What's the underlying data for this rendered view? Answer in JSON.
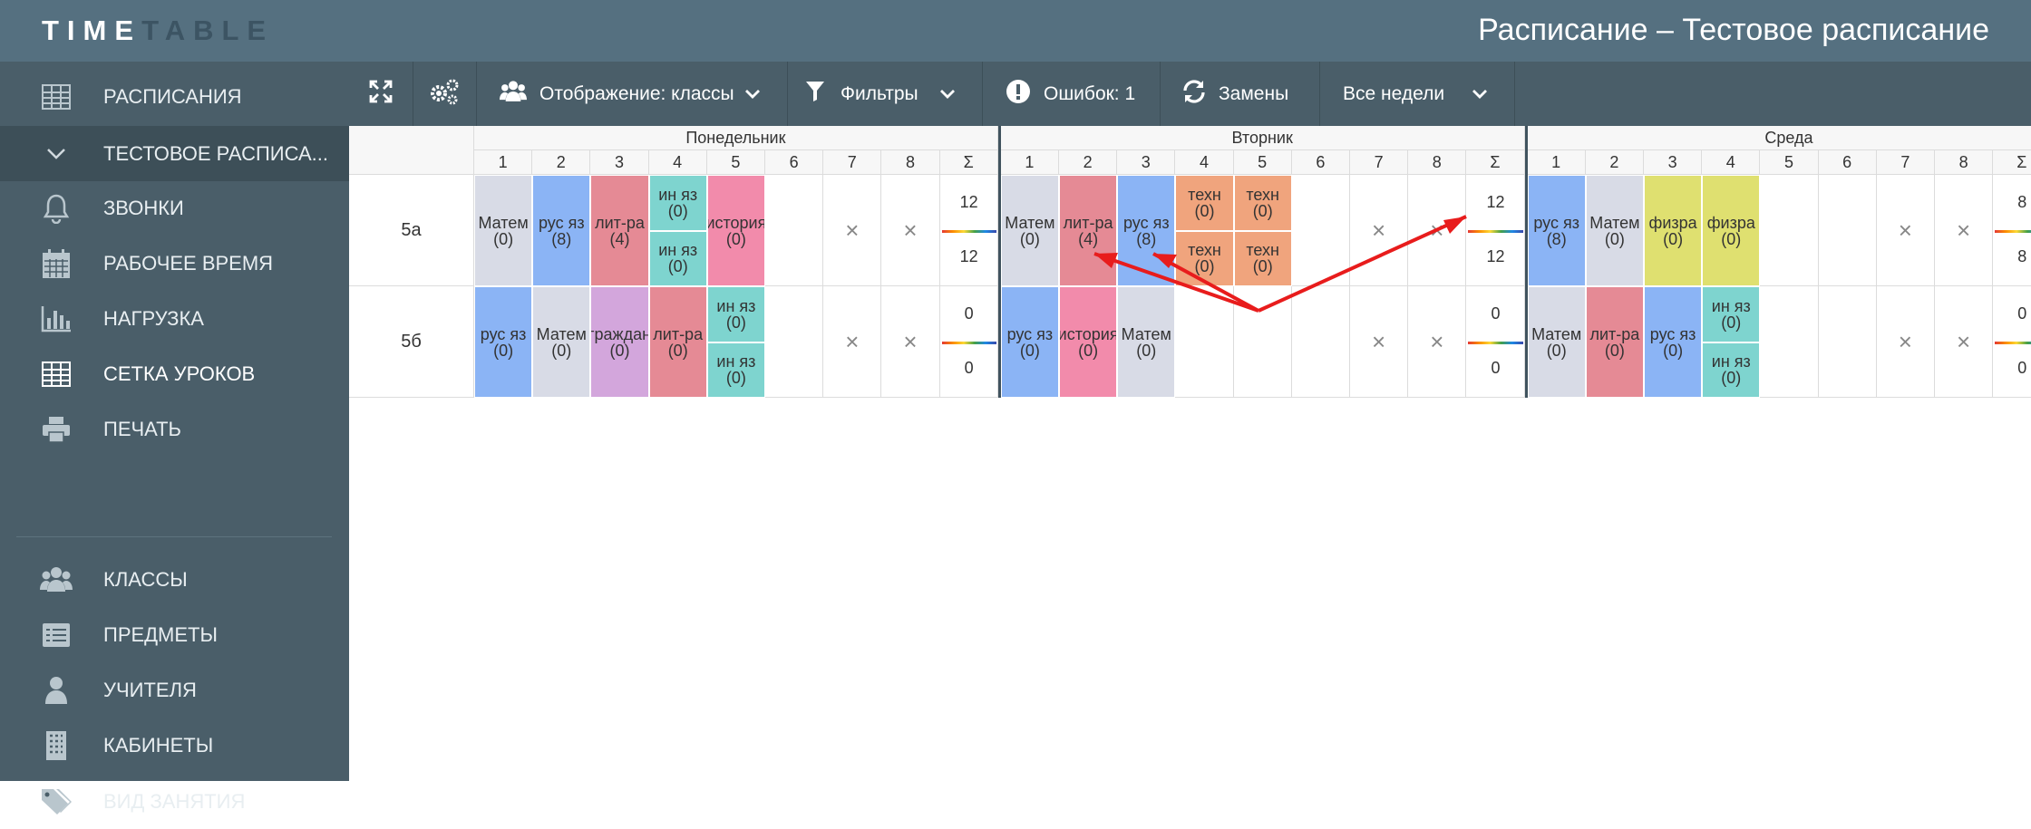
{
  "app": {
    "logo_part1": "TIME",
    "logo_part2": "TABLE",
    "title": "Расписание – Тестовое расписание"
  },
  "sidebar": {
    "items": [
      {
        "label": "РАСПИСАНИЯ",
        "icon": "table-icon"
      },
      {
        "label": "ТЕСТОВОЕ РАСПИСА...",
        "icon": "chevron-down-icon",
        "active": true
      },
      {
        "label": "ЗВОНКИ",
        "icon": "bell-icon"
      },
      {
        "label": "РАБОЧЕЕ ВРЕМЯ",
        "icon": "calendar-icon"
      },
      {
        "label": "НАГРУЗКА",
        "icon": "bar-chart-icon"
      },
      {
        "label": "СЕТКА УРОКОВ",
        "icon": "grid-icon",
        "current": true
      },
      {
        "label": "ПЕЧАТЬ",
        "icon": "printer-icon"
      },
      {
        "label": "КЛАССЫ",
        "icon": "users-icon"
      },
      {
        "label": "ПРЕДМЕТЫ",
        "icon": "list-icon"
      },
      {
        "label": "УЧИТЕЛЯ",
        "icon": "user-icon"
      },
      {
        "label": "КАБИНЕТЫ",
        "icon": "building-icon"
      },
      {
        "label": "ВИД ЗАНЯТИЯ",
        "icon": "tags-icon"
      }
    ]
  },
  "toolbar": {
    "fullscreen_icon": "expand-icon",
    "settings_icon": "gears-icon",
    "display_label": "Отображение: классы",
    "filters_label": "Фильтры",
    "errors_label": "Ошибок: 1",
    "replacements_label": "Замены",
    "weeks_label": "Все недели"
  },
  "schedule": {
    "days": [
      "Понедельник",
      "Вторник",
      "Среда"
    ],
    "periods": [
      "1",
      "2",
      "3",
      "4",
      "5",
      "6",
      "7",
      "8",
      "Σ"
    ],
    "classes": [
      "5а",
      "5б"
    ],
    "colors": {
      "math": "#d8dbe6",
      "rus": "#8bb4f5",
      "lit": "#e58a95",
      "lang": "#7ed4cf",
      "hist": "#f28bab",
      "civ": "#d3a6dc",
      "tech": "#f0a47d",
      "pe": "#dfe070"
    },
    "rows": [
      {
        "days": [
          {
            "lessons": [
              {
                "p": 0,
                "text": "Матем (0)",
                "c": "math"
              },
              {
                "p": 1,
                "text": "рус яз (8)",
                "c": "rus"
              },
              {
                "p": 2,
                "text": "лит-ра (4)",
                "c": "lit"
              },
              {
                "p": 3,
                "text": "ин яз (0)",
                "c": "lang",
                "half": "top"
              },
              {
                "p": 3,
                "text": "ин яз (0)",
                "c": "lang",
                "half": "bottom"
              },
              {
                "p": 4,
                "text": "история (0)",
                "c": "hist"
              }
            ],
            "x": [
              6,
              7
            ],
            "sum_top": "12",
            "sum_bottom": "12"
          },
          {
            "lessons": [
              {
                "p": 0,
                "text": "Матем (0)",
                "c": "math"
              },
              {
                "p": 1,
                "text": "лит-ра (4)",
                "c": "lit"
              },
              {
                "p": 2,
                "text": "рус яз (8)",
                "c": "rus"
              },
              {
                "p": 3,
                "text": "техн (0)",
                "c": "tech",
                "half": "top"
              },
              {
                "p": 3,
                "text": "техн (0)",
                "c": "tech",
                "half": "bottom"
              },
              {
                "p": 4,
                "text": "техн (0)",
                "c": "tech",
                "half": "top"
              },
              {
                "p": 4,
                "text": "техн (0)",
                "c": "tech",
                "half": "bottom"
              }
            ],
            "x": [
              6,
              7
            ],
            "sum_top": "12",
            "sum_bottom": "12"
          },
          {
            "lessons": [
              {
                "p": 0,
                "text": "рус яз (8)",
                "c": "rus"
              },
              {
                "p": 1,
                "text": "Матем (0)",
                "c": "math"
              },
              {
                "p": 2,
                "text": "физра (0)",
                "c": "pe"
              },
              {
                "p": 3,
                "text": "физра (0)",
                "c": "pe"
              }
            ],
            "x": [
              6,
              7
            ],
            "sum_top": "8",
            "sum_bottom": "8"
          }
        ]
      },
      {
        "days": [
          {
            "lessons": [
              {
                "p": 0,
                "text": "рус яз (0)",
                "c": "rus"
              },
              {
                "p": 1,
                "text": "Матем (0)",
                "c": "math"
              },
              {
                "p": 2,
                "text": "граждан (0)",
                "c": "civ"
              },
              {
                "p": 3,
                "text": "лит-ра (0)",
                "c": "lit"
              },
              {
                "p": 4,
                "text": "ин яз (0)",
                "c": "lang",
                "half": "top"
              },
              {
                "p": 4,
                "text": "ин яз (0)",
                "c": "lang",
                "half": "bottom"
              }
            ],
            "x": [
              6,
              7
            ],
            "sum_top": "0",
            "sum_bottom": "0"
          },
          {
            "lessons": [
              {
                "p": 0,
                "text": "рус яз (0)",
                "c": "rus"
              },
              {
                "p": 1,
                "text": "история (0)",
                "c": "hist"
              },
              {
                "p": 2,
                "text": "Матем (0)",
                "c": "math"
              }
            ],
            "x": [
              6,
              7
            ],
            "sum_top": "0",
            "sum_bottom": "0"
          },
          {
            "lessons": [
              {
                "p": 0,
                "text": "Матем (0)",
                "c": "math"
              },
              {
                "p": 1,
                "text": "лит-ра (0)",
                "c": "lit"
              },
              {
                "p": 2,
                "text": "рус яз (0)",
                "c": "rus"
              },
              {
                "p": 3,
                "text": "ин яз (0)",
                "c": "lang",
                "half": "top"
              },
              {
                "p": 3,
                "text": "ин яз (0)",
                "c": "lang",
                "half": "bottom"
              }
            ],
            "x": [
              6,
              7
            ],
            "sum_top": "0",
            "sum_bottom": "0"
          }
        ]
      }
    ]
  },
  "annotation": {
    "color": "#e81c1c"
  }
}
